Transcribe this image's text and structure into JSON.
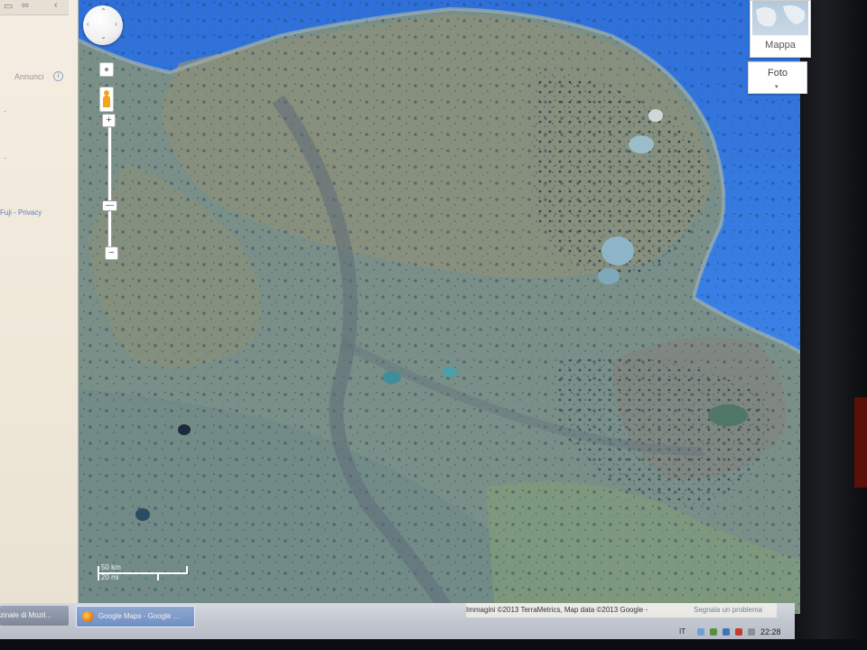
{
  "sidebar": {
    "ads_label": "Annunci",
    "info_glyph": "i",
    "legal_text": "Fuji - Privacy",
    "dash1": "-",
    "dash2": "-",
    "top_icons": [
      "tab-icon",
      "link-icon",
      "chevron-left-icon"
    ]
  },
  "map": {
    "view": "satellite",
    "controls": {
      "zoom_in": "+",
      "zoom_out": "−",
      "zoom_level_fraction": 0.65
    },
    "map_type": {
      "map_label": "Mappa",
      "photo_label": "Foto",
      "caret": "▾"
    },
    "scale": {
      "km": "50 km",
      "mi": "20 mi"
    },
    "attribution": {
      "imagery": "Immagini ©2013 TerraMetrics, Map data ©2013 Google -",
      "report": "Segnala un problema"
    },
    "colors": {
      "sea": "#3b82e8",
      "land": "#6f8b86"
    }
  },
  "taskbar": {
    "task1": "zinale di Mozil...",
    "task2": "Google Maps - Google ...",
    "lang": "IT",
    "clock": "22:28"
  }
}
